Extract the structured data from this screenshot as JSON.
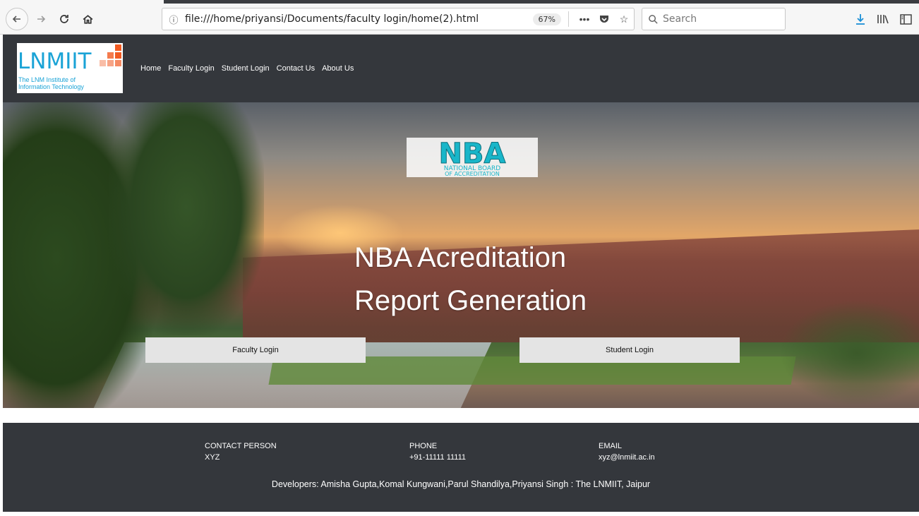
{
  "browser": {
    "url": "file:///home/priyansi/Documents/faculty login/home(2).html",
    "zoom": "67%",
    "search_placeholder": "Search"
  },
  "header": {
    "logo": {
      "title": "LNMIIT",
      "subtitle_line1": "The LNM Institute of",
      "subtitle_line2": "Information Technology"
    },
    "nav": [
      "Home",
      "Faculty Login",
      "Student Login",
      "Contact Us",
      "About Us"
    ]
  },
  "hero": {
    "badge_main": "NBA",
    "badge_line1": "NATIONAL BOARD",
    "badge_line2": "OF ACCREDITATION",
    "title_line1": "NBA Acreditation",
    "title_line2": "Report Generation",
    "faculty_button": "Faculty Login",
    "student_button": "Student Login"
  },
  "footer": {
    "contact_label": "CONTACT PERSON",
    "contact_value": "XYZ",
    "phone_label": "PHONE",
    "phone_value": "+91-11111 11111",
    "email_label": "EMAIL",
    "email_value": "xyz@lnmiit.ac.in",
    "developers": "Developers: Amisha Gupta,Komal Kungwani,Parul Shandilya,Priyansi Singh : The LNMIIT, Jaipur"
  },
  "colors": {
    "header_bg": "#34373c",
    "logo_blue": "#1aa3d6",
    "logo_orange": "#f15a22",
    "button_bg": "#e4e4e4",
    "nba_teal": "#19b6c9"
  }
}
